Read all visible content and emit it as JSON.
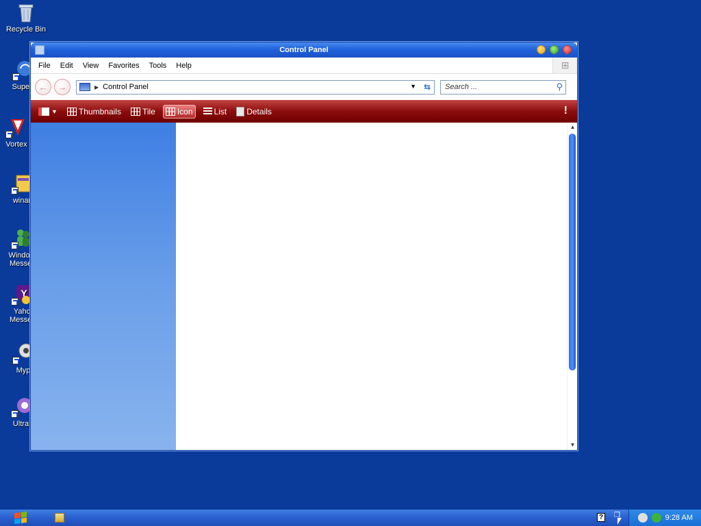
{
  "desktop": {
    "icons": [
      {
        "label": "Recycle Bin",
        "icon": "recycle-bin-icon"
      },
      {
        "label": "Superr",
        "icon": "superr-shortcut-icon"
      },
      {
        "label": "Vortex",
        "icon": "vortex-shortcut-icon"
      },
      {
        "label": "winar",
        "icon": "winar-shortcut-icon"
      },
      {
        "label": "Window\nMesser",
        "icon": "windows-messenger-icon"
      },
      {
        "label": "Yahc\nMesser",
        "icon": "yahoo-messenger-icon"
      },
      {
        "label": "Myp",
        "icon": "myp-shortcut-icon"
      },
      {
        "label": "UltraI",
        "icon": "ultra-shortcut-icon"
      }
    ]
  },
  "window": {
    "title": "Control Panel",
    "menu": [
      "File",
      "Edit",
      "View",
      "Favorites",
      "Tools",
      "Help"
    ],
    "address": {
      "path": "Control Panel"
    },
    "search": {
      "placeholder": "Search ..."
    },
    "toolbar": {
      "views": [
        {
          "label": "Thumbnails",
          "active": false
        },
        {
          "label": "Tile",
          "active": false
        },
        {
          "label": "Icon",
          "active": true
        },
        {
          "label": "List",
          "active": false
        },
        {
          "label": "Details",
          "active": false
        }
      ],
      "warning": "!"
    }
  },
  "taskbar": {
    "clock": "9:28 AM",
    "help_glyph": "?"
  },
  "colors": {
    "desktop": "#0a3a9a",
    "titlebar": "#2062dc",
    "toolbar": "#8c0d0d",
    "sidepane": "#5a90e6"
  }
}
